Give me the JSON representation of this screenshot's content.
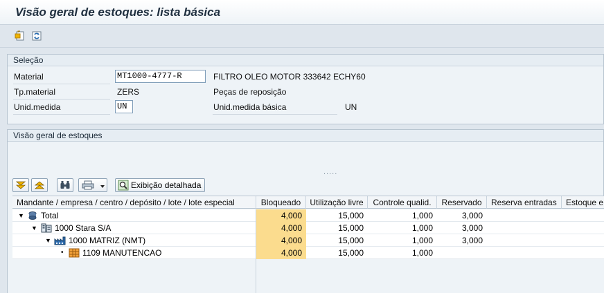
{
  "window": {
    "title": "Visão geral de estoques: lista básica"
  },
  "selection": {
    "group_title": "Seleção",
    "material_label": "Material",
    "material_value": "MT1000-4777-R",
    "material_desc": "FILTRO OLEO MOTOR 333642 ECHY60",
    "tp_material_label": "Tp.material",
    "tp_material_value": "ZERS",
    "tp_material_desc": "Peças de reposição",
    "unid_label": "Unid.medida",
    "unid_value": "UN",
    "unid_basica_label": "Unid.medida básica",
    "unid_basica_value": "UN"
  },
  "overview": {
    "group_title": "Visão geral de estoques",
    "splitter_dots": ".....",
    "detail_button": "Exibição detalhada"
  },
  "grid": {
    "headers": [
      "Mandante / empresa / centro / depósito / lote / lote especial",
      "Bloqueado",
      "Utilização livre",
      "Controle qualid.",
      "Reservado",
      "Reserva entradas",
      "Estoque e"
    ],
    "rows": [
      {
        "label": "Total",
        "bloqueado": "4,000",
        "livre": "15,000",
        "qualid": "1,000",
        "reservado": "3,000"
      },
      {
        "label": "1000 Stara S/A",
        "bloqueado": "4,000",
        "livre": "15,000",
        "qualid": "1,000",
        "reservado": "3,000"
      },
      {
        "label": "1000 MATRIZ (NMT)",
        "bloqueado": "4,000",
        "livre": "15,000",
        "qualid": "1,000",
        "reservado": "3,000"
      },
      {
        "label": "1109 MANUTENCAO",
        "bloqueado": "4,000",
        "livre": "15,000",
        "qualid": "1,000",
        "reservado": ""
      }
    ]
  },
  "colors": {
    "bloqueado_highlight": "#fbdc8e",
    "background": "#dfe6ed"
  }
}
